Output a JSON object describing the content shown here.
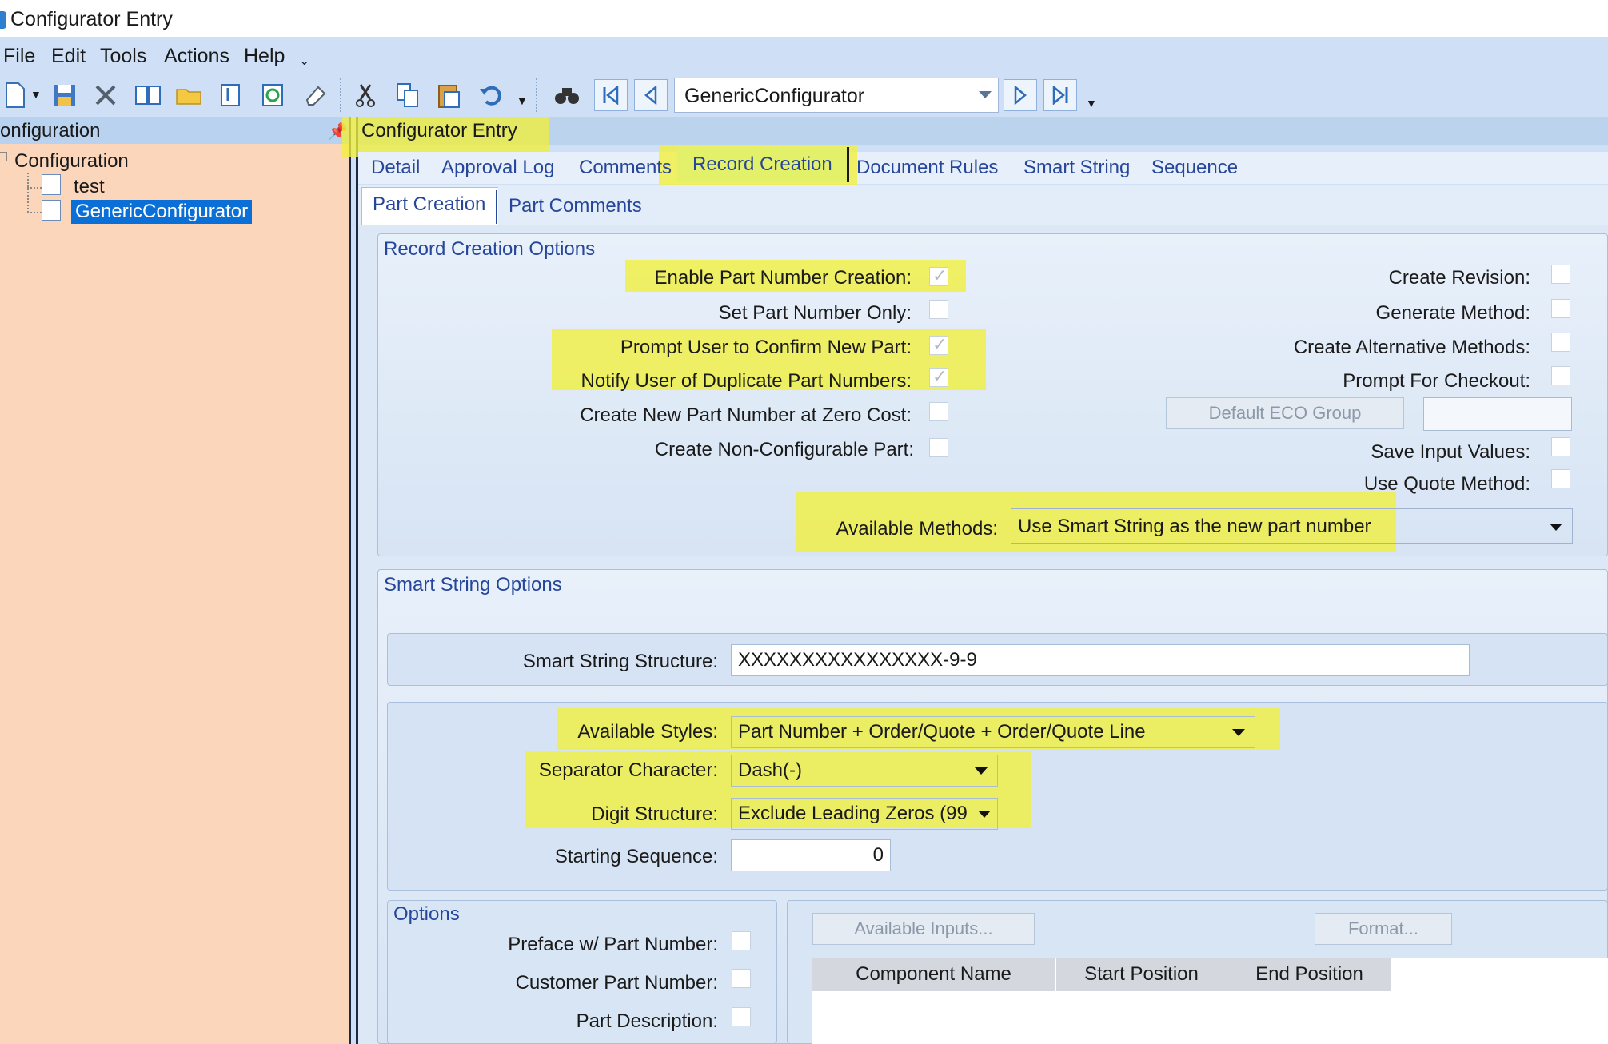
{
  "window": {
    "title": "Configurator Entry"
  },
  "menu": [
    "File",
    "Edit",
    "Tools",
    "Actions",
    "Help"
  ],
  "toolbar": {
    "icons": [
      "new-icon",
      "save-icon",
      "delete-icon",
      "book-icon",
      "folder-icon",
      "attach-icon",
      "refresh-icon",
      "eraser-icon",
      "cut-icon",
      "copy-icon",
      "paste-icon",
      "undo-icon",
      "search-icon"
    ],
    "record_combo": "GenericConfigurator"
  },
  "tree_panel": {
    "header": "onfiguration",
    "root": "Configuration",
    "items": [
      "test",
      "GenericConfigurator"
    ]
  },
  "main": {
    "caption": "Configurator Entry",
    "tabs": [
      "Detail",
      "Approval Log",
      "Comments",
      "Record Creation",
      "Document Rules",
      "Smart String",
      "Sequence"
    ],
    "subtabs": [
      "Part Creation",
      "Part Comments"
    ]
  },
  "record_creation_options": {
    "title": "Record Creation Options",
    "left": [
      {
        "label": "Enable Part Number Creation:",
        "checked": true
      },
      {
        "label": "Set Part Number Only:",
        "checked": false
      },
      {
        "label": "Prompt User to Confirm New Part:",
        "checked": true
      },
      {
        "label": "Notify User of Duplicate Part Numbers:",
        "checked": true
      },
      {
        "label": "Create New Part Number at Zero Cost:",
        "checked": false
      },
      {
        "label": "Create Non-Configurable Part:",
        "checked": false
      }
    ],
    "right": [
      {
        "label": "Create Revision:",
        "checked": false
      },
      {
        "label": "Generate Method:",
        "checked": false
      },
      {
        "label": "Create Alternative Methods:",
        "checked": false
      },
      {
        "label": "Prompt For Checkout:",
        "checked": false
      },
      {
        "label": "Save Input Values:",
        "checked": false
      },
      {
        "label": "Use Quote Method:",
        "checked": false
      }
    ],
    "default_eco_button": "Default ECO Group",
    "available_methods_label": "Available Methods:",
    "available_methods_value": "Use Smart String as the new part number"
  },
  "smart_string_options": {
    "title": "Smart String Options",
    "structure_label": "Smart String Structure:",
    "structure_value": "XXXXXXXXXXXXXXXX-9-9",
    "styles_label": "Available Styles:",
    "styles_value": "Part Number + Order/Quote + Order/Quote Line",
    "separator_label": "Separator Character:",
    "separator_value": "Dash(-)",
    "digit_label": "Digit Structure:",
    "digit_value": "Exclude Leading Zeros (99",
    "start_label": "Starting Sequence:",
    "start_value": "0"
  },
  "options": {
    "title": "Options",
    "items": [
      {
        "label": "Preface w/ Part Number:",
        "checked": false
      },
      {
        "label": "Customer Part Number:",
        "checked": false
      },
      {
        "label": "Part Description:",
        "checked": false
      }
    ],
    "available_inputs_button": "Available Inputs...",
    "format_button": "Format...",
    "grid_columns": [
      "Component Name",
      "Start Position",
      "End Position"
    ]
  },
  "colors": {
    "highlight": "#f1f03a",
    "left_panel": "#fbd6ba",
    "selection": "#0a6fd6",
    "chrome": "#cfe0f6"
  }
}
